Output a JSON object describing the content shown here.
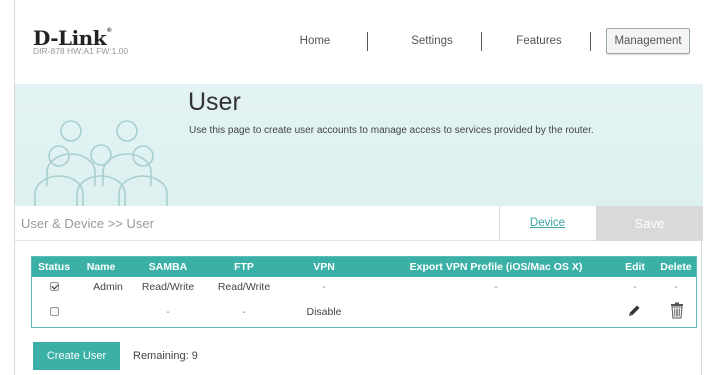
{
  "brand": {
    "logo": "D-Link",
    "logo_mark": "®",
    "model": "DIR-878 HW:A1 FW:1.00"
  },
  "nav": {
    "home": "Home",
    "settings": "Settings",
    "features": "Features",
    "management": "Management"
  },
  "hero": {
    "title": "User",
    "description": "Use this page to create user accounts to manage access to services provided by the router."
  },
  "breadcrumb": {
    "text": "User & Device >> User",
    "device_link": "Device",
    "save_label": "Save"
  },
  "table": {
    "headers": {
      "status": "Status",
      "name": "Name",
      "samba": "SAMBA",
      "ftp": "FTP",
      "vpn": "VPN",
      "export": "Export VPN Profile (iOS/Mac OS X)",
      "edit": "Edit",
      "delete": "Delete"
    },
    "rows": [
      {
        "checked": true,
        "name": "Admin",
        "samba": "Read/Write",
        "ftp": "Read/Write",
        "vpn": "-",
        "export": "-",
        "edit": "-",
        "delete": "-"
      },
      {
        "checked": false,
        "name": "",
        "samba": "-",
        "ftp": "-",
        "vpn": "Disable",
        "export": "",
        "edit_icon": "pencil-icon",
        "delete_icon": "trash-icon"
      }
    ]
  },
  "footer": {
    "create_label": "Create User",
    "remaining": "Remaining: 9"
  },
  "colors": {
    "accent": "#3bb0a6",
    "hero_bg": "#e0f2f2",
    "link": "#3aa3a0",
    "save_disabled": "#d9d9d9"
  }
}
